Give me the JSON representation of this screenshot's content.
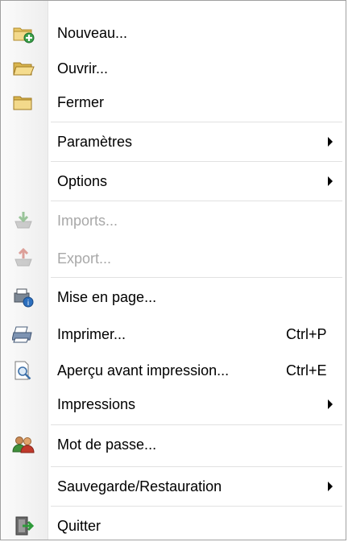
{
  "menu": {
    "items": [
      {
        "label": "Nouveau...",
        "icon": "new-folder-icon"
      },
      {
        "label": "Ouvrir...",
        "icon": "open-folder-icon"
      },
      {
        "label": "Fermer",
        "icon": "folder-icon"
      },
      {
        "label": "Paramètres",
        "submenu": true
      },
      {
        "label": "Options",
        "submenu": true
      },
      {
        "label": "Imports...",
        "icon": "import-icon",
        "disabled": true
      },
      {
        "label": "Export...",
        "icon": "export-icon",
        "disabled": true
      },
      {
        "label": "Mise en page...",
        "icon": "page-setup-icon"
      },
      {
        "label": "Imprimer...",
        "icon": "printer-icon",
        "shortcut": "Ctrl+P"
      },
      {
        "label": "Aperçu avant impression...",
        "icon": "print-preview-icon",
        "shortcut": "Ctrl+E"
      },
      {
        "label": "Impressions",
        "submenu": true
      },
      {
        "label": "Mot de passe...",
        "icon": "users-icon"
      },
      {
        "label": "Sauvegarde/Restauration",
        "submenu": true
      },
      {
        "label": "Quitter",
        "icon": "exit-door-icon"
      }
    ]
  },
  "colors": {
    "text": "#000000",
    "disabled_text": "#a8a8a8",
    "separator": "#e1e1e1",
    "border": "#a0a0a0"
  }
}
